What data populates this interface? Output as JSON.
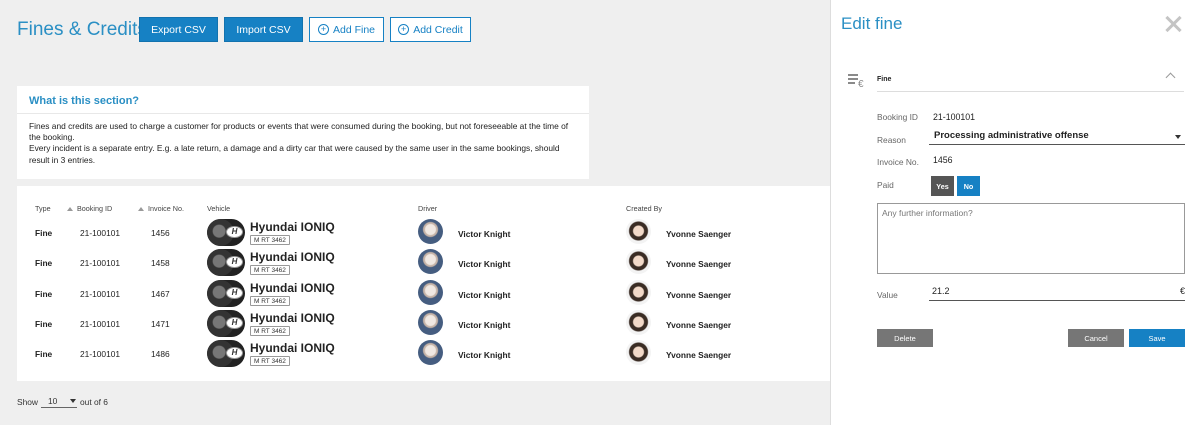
{
  "header": {
    "title": "Fines & Credits",
    "export_label": "Export CSV",
    "import_label": "Import CSV",
    "add_fine_label": "Add Fine",
    "add_credit_label": "Add Credit"
  },
  "info": {
    "title": "What is this section?",
    "line1": "Fines and credits are used to charge a customer for products or events that were consumed during the booking, but not foreseeable at the time of the booking.",
    "line2": "Every incident is a separate entry. E.g. a late return, a damage and a dirty car that were caused by the same user in the same bookings, should result in 3 entries."
  },
  "table": {
    "columns": [
      "Type",
      "Booking ID",
      "Invoice No.",
      "Vehicle",
      "Driver",
      "Created By"
    ],
    "rows": [
      {
        "type": "Fine",
        "booking_id": "21-100101",
        "invoice": "1456",
        "vehicle": "Hyundai IONIQ",
        "plate": "M RT 3462",
        "driver": "Victor Knight",
        "created_by": "Yvonne Saenger"
      },
      {
        "type": "Fine",
        "booking_id": "21-100101",
        "invoice": "1458",
        "vehicle": "Hyundai IONIQ",
        "plate": "M RT 3462",
        "driver": "Victor Knight",
        "created_by": "Yvonne Saenger"
      },
      {
        "type": "Fine",
        "booking_id": "21-100101",
        "invoice": "1467",
        "vehicle": "Hyundai IONIQ",
        "plate": "M RT 3462",
        "driver": "Victor Knight",
        "created_by": "Yvonne Saenger"
      },
      {
        "type": "Fine",
        "booking_id": "21-100101",
        "invoice": "1471",
        "vehicle": "Hyundai IONIQ",
        "plate": "M RT 3462",
        "driver": "Victor Knight",
        "created_by": "Yvonne Saenger"
      },
      {
        "type": "Fine",
        "booking_id": "21-100101",
        "invoice": "1486",
        "vehicle": "Hyundai IONIQ",
        "plate": "M RT 3462",
        "driver": "Victor Knight",
        "created_by": "Yvonne Saenger"
      }
    ]
  },
  "pagination": {
    "show_label": "Show",
    "page_size": "10",
    "out_of_label": "out of 6"
  },
  "panel": {
    "title": "Edit fine",
    "section_label": "Fine",
    "booking_label": "Booking ID",
    "booking_value": "21-100101",
    "reason_label": "Reason",
    "reason_value": "Processing administrative offense",
    "invoice_label": "Invoice No.",
    "invoice_value": "1456",
    "paid_label": "Paid",
    "yes_label": "Yes",
    "no_label": "No",
    "notes_placeholder": "Any further information?",
    "value_label": "Value",
    "value_value": "21.2",
    "currency": "€",
    "delete_label": "Delete",
    "cancel_label": "Cancel",
    "save_label": "Save"
  },
  "colors": {
    "accent": "#1681c4",
    "title": "#2a8fc4",
    "neutral_button": "#767676"
  }
}
